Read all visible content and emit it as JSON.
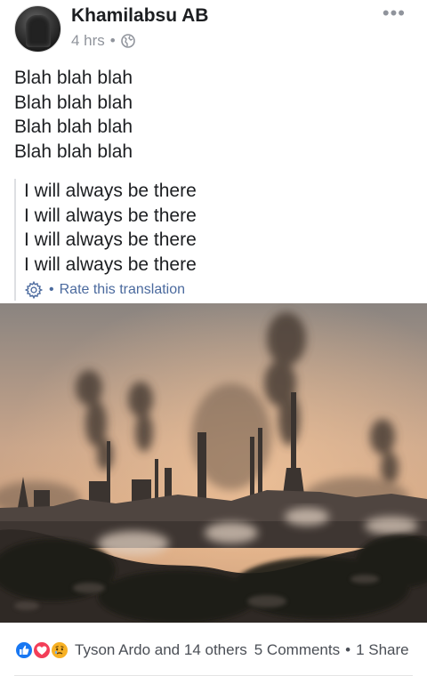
{
  "post": {
    "author": "Khamilabsu AB",
    "time": "4 hrs",
    "separator": "•",
    "privacy_icon": "globe-icon",
    "more_icon": "more-options-icon",
    "text_lines": [
      "Blah blah blah",
      "Blah blah blah",
      "Blah blah blah",
      "Blah blah blah"
    ]
  },
  "translation": {
    "lines": [
      "I will always be there",
      "I will always be there",
      "I will always be there",
      "I will always be there"
    ],
    "settings_icon": "gear-icon",
    "separator": "•",
    "rate_label": "Rate this translation"
  },
  "photo": {
    "subject": "industrial-smokestacks-photo"
  },
  "engagement": {
    "reaction_icons": [
      "like-icon",
      "love-icon",
      "sad-icon"
    ],
    "reactors": "Tyson Ardo and 14 others",
    "comments": "5 Comments",
    "separator": "•",
    "shares": "1 Share"
  },
  "colors": {
    "text": "#1c1e21",
    "meta": "#90949c",
    "link": "#4b6a9e",
    "like": "#1877f2",
    "love": "#f33e58",
    "sad": "#f7b125"
  }
}
